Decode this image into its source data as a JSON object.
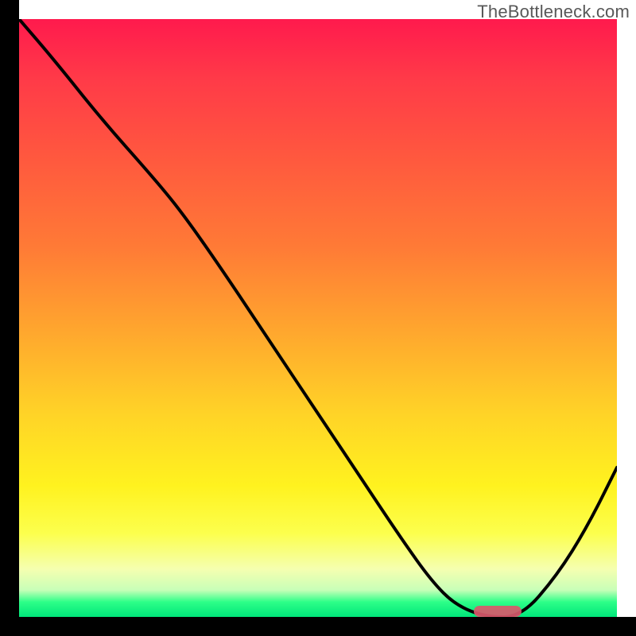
{
  "attribution": "TheBottleneck.com",
  "colors": {
    "top": "#ff1a4d",
    "mid": "#ffd327",
    "bottom": "#00e67a",
    "curve": "#000000",
    "marker": "#d9586b",
    "axis": "#000000"
  },
  "chart_data": {
    "type": "line",
    "title": "",
    "xlabel": "",
    "ylabel": "",
    "xlim": [
      0,
      100
    ],
    "ylim": [
      0,
      100
    ],
    "x": [
      0,
      6,
      14,
      22,
      27,
      34,
      42,
      50,
      58,
      64,
      69,
      73,
      78,
      84,
      90,
      95,
      100
    ],
    "values": [
      100,
      93,
      83,
      74,
      68,
      58,
      46,
      34,
      22,
      13,
      6,
      2,
      0,
      0,
      7,
      15,
      25
    ],
    "marker": {
      "x_start": 76,
      "x_end": 84,
      "y": 0
    },
    "grid": false,
    "legend": false
  }
}
